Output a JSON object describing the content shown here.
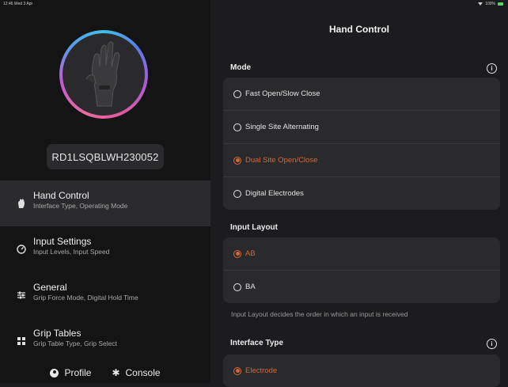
{
  "status_bar": {
    "time": "12:46 Wed 3 Apr",
    "battery": "100%"
  },
  "device": {
    "serial": "RD1LSQBLWH230052"
  },
  "nav": [
    {
      "title": "Hand Control",
      "subtitle": "Interface Type, Operating Mode",
      "icon": "hand-icon",
      "active": true
    },
    {
      "title": "Input Settings",
      "subtitle": "Input Levels, Input Speed",
      "icon": "gauge-icon",
      "active": false
    },
    {
      "title": "General",
      "subtitle": "Grip Force Mode, Digital Hold Time",
      "icon": "sliders-icon",
      "active": false
    },
    {
      "title": "Grip Tables",
      "subtitle": "Grip Table Type, Grip Select",
      "icon": "grid-icon",
      "active": false
    }
  ],
  "footer": {
    "profile": "Profile",
    "console": "Console"
  },
  "main": {
    "title": "Hand Control",
    "mode": {
      "label": "Mode",
      "options": [
        "Fast Open/Slow Close",
        "Single Site Alternating",
        "Dual Site Open/Close",
        "Digital Electrodes"
      ],
      "selected": "Dual Site Open/Close"
    },
    "input_layout": {
      "label": "Input Layout",
      "options": [
        "AB",
        "BA"
      ],
      "selected": "AB",
      "caption": "Input Layout decides the order in which an input is received"
    },
    "interface_type": {
      "label": "Interface Type",
      "options": [
        "Electrode"
      ],
      "selected": "Electrode"
    }
  },
  "colors": {
    "accent": "#d4693a",
    "background": "#1c1c1e",
    "sidebar": "#141414",
    "card": "#2a2a2c"
  }
}
